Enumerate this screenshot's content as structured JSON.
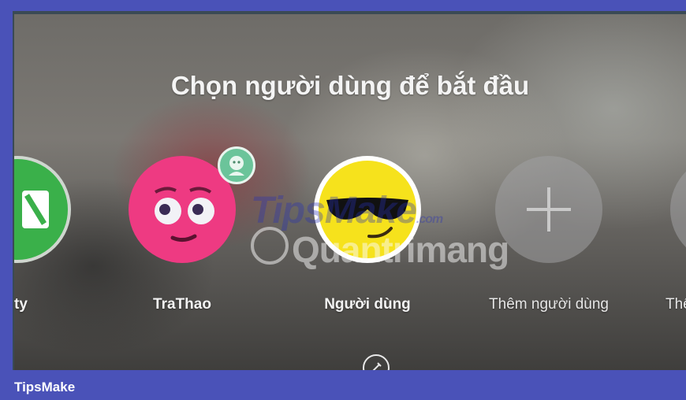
{
  "title": "Chọn người dùng để bắt đầu",
  "profiles": [
    {
      "label": "ty",
      "color": "#3ab04a"
    },
    {
      "label": "TraThao",
      "color": "#ee3a82",
      "badge": "child-profile-icon"
    },
    {
      "label": "Người dùng",
      "color": "#f6e21c"
    },
    {
      "label": "Thêm người dùng",
      "icon": "plus-icon"
    },
    {
      "label": "Thê",
      "icon": "plus-icon"
    }
  ],
  "edit_icon": "pencil-icon",
  "watermark": {
    "line1": "TipsMake",
    "line1_suffix": ".com",
    "line2": "Quantrimang"
  },
  "footer": {
    "brand": "TipsMake"
  },
  "colors": {
    "border": "#4a52b8",
    "accent": "#f6e21c"
  }
}
